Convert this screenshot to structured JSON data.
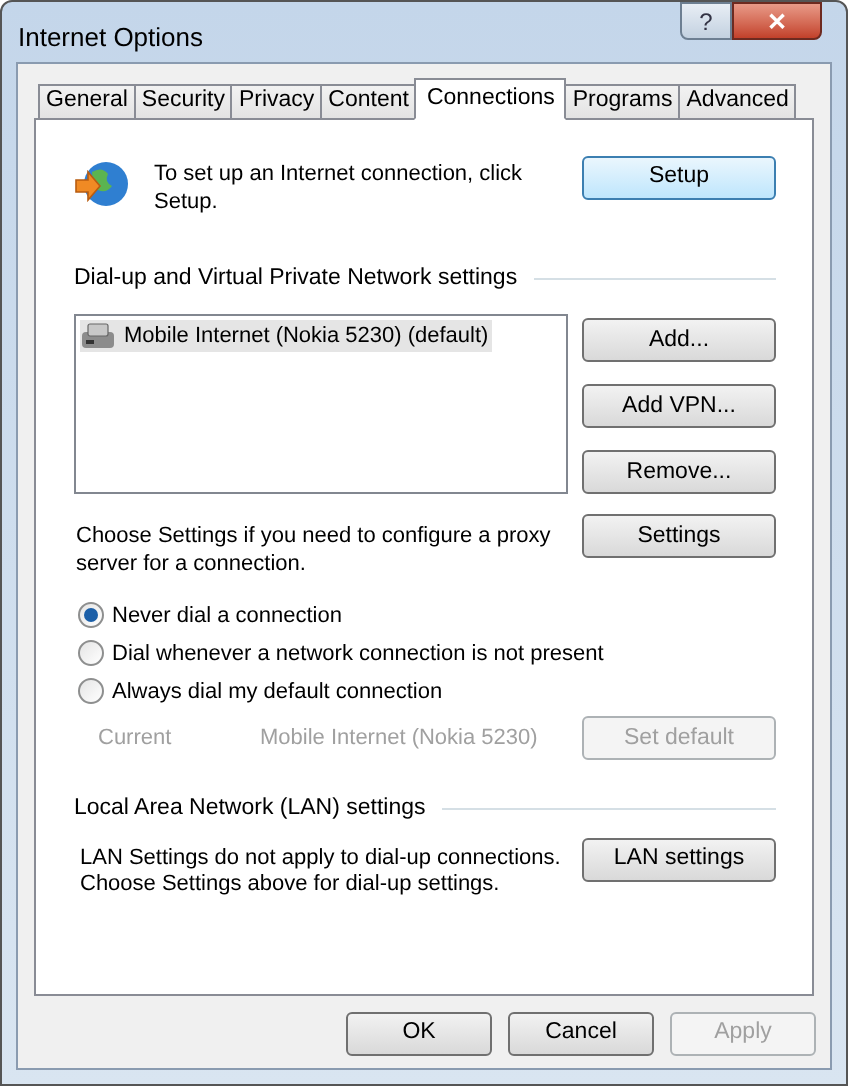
{
  "window": {
    "title": "Internet Options",
    "help_button": "?",
    "close_button": "✕"
  },
  "tabs": [
    {
      "label": "General",
      "selected": false
    },
    {
      "label": "Security",
      "selected": false
    },
    {
      "label": "Privacy",
      "selected": false
    },
    {
      "label": "Content",
      "selected": false
    },
    {
      "label": "Connections",
      "selected": true
    },
    {
      "label": "Programs",
      "selected": false
    },
    {
      "label": "Advanced",
      "selected": false
    }
  ],
  "setup": {
    "text": "To set up an Internet connection, click Setup.",
    "button": {
      "label": "Setup",
      "default": true,
      "disabled": false
    }
  },
  "dialup": {
    "heading": "Dial-up and Virtual Private Network settings",
    "connections": [
      {
        "name": "Mobile Internet (Nokia 5230) (default)",
        "selected": true
      }
    ],
    "buttons": [
      {
        "label": "Add...",
        "disabled": false
      },
      {
        "label": "Add VPN...",
        "disabled": false
      },
      {
        "label": "Remove...",
        "disabled": false
      }
    ],
    "proxy_text": "Choose Settings if you need to configure a proxy server for a connection.",
    "settings_button": {
      "label": "Settings",
      "disabled": false
    },
    "options": [
      {
        "label": "Never dial a connection",
        "selected": true
      },
      {
        "label": "Dial whenever a network connection is not present",
        "selected": false
      },
      {
        "label": "Always dial my default connection",
        "selected": false
      }
    ],
    "current_label": "Current",
    "current_value": "Mobile Internet (Nokia 5230)",
    "set_default_button": {
      "label": "Set default",
      "disabled": true
    }
  },
  "lan": {
    "heading": "Local Area Network (LAN) settings",
    "text": "LAN Settings do not apply to dial-up connections. Choose Settings above for dial-up settings.",
    "button": {
      "label": "LAN settings",
      "disabled": false
    }
  },
  "footer_buttons": [
    {
      "label": "OK",
      "disabled": false
    },
    {
      "label": "Cancel",
      "disabled": false
    },
    {
      "label": "Apply",
      "disabled": true
    }
  ]
}
